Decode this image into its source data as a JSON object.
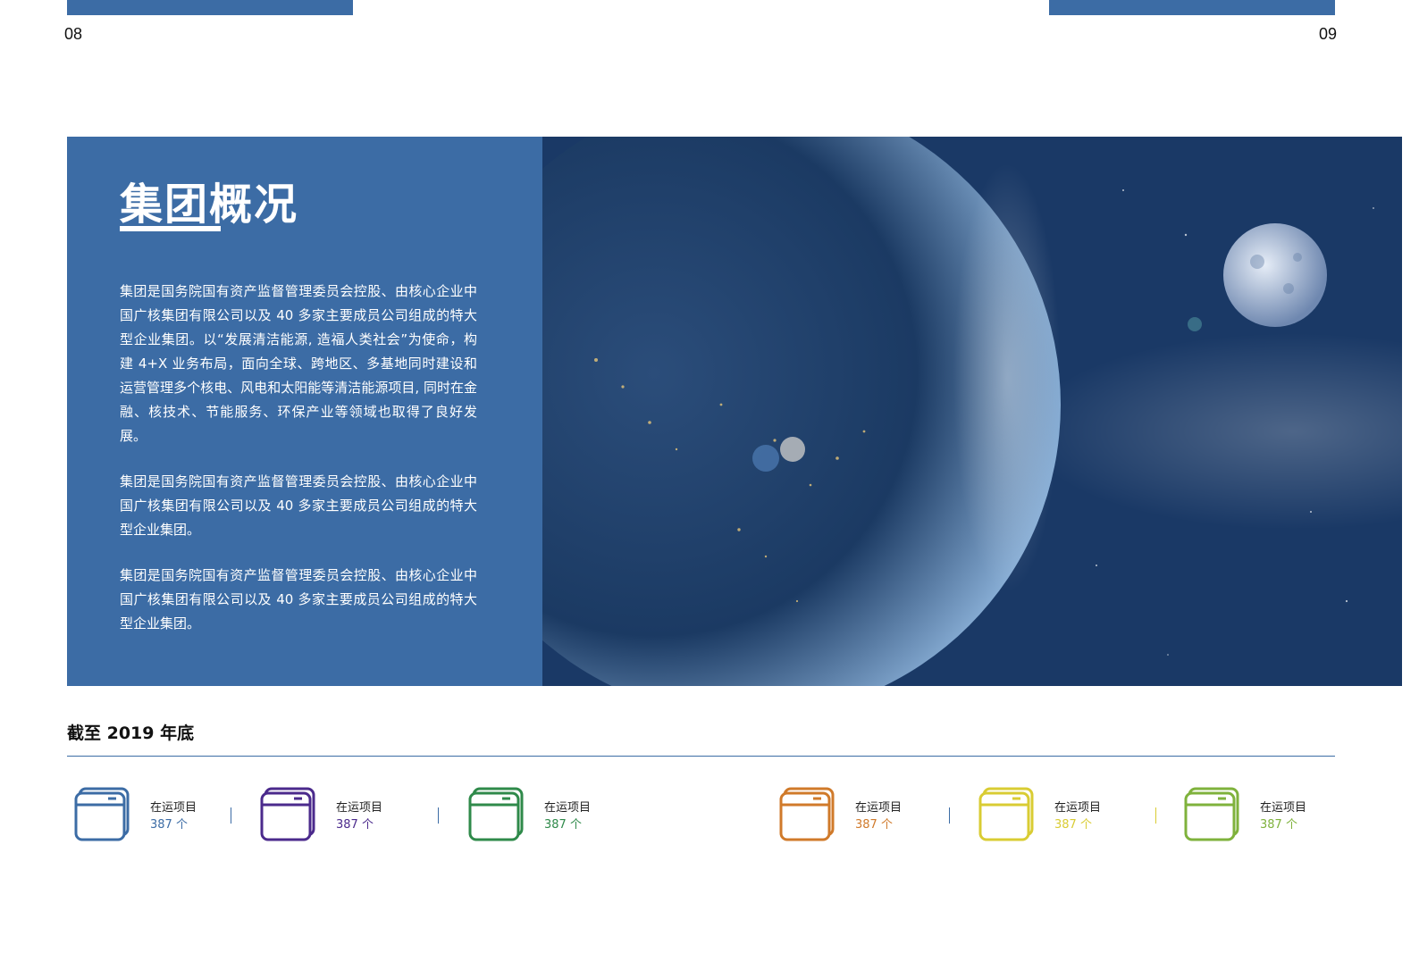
{
  "page_numbers": {
    "left": "08",
    "right": "09"
  },
  "colors": {
    "brand_blue": "#3c6ca5"
  },
  "hero": {
    "title": "集团概况",
    "paragraphs": [
      "集团是国务院国有资产监督管理委员会控股、由核心企业中国广核集团有限公司以及 40 多家主要成员公司组成的特大型企业集团。以“发展清洁能源, 造福人类社会”为使命，构建 4+X 业务布局，面向全球、跨地区、多基地同时建设和运营管理多个核电、风电和太阳能等清洁能源项目, 同时在金融、核技术、节能服务、环保产业等领域也取得了良好发展。",
      "集团是国务院国有资产监督管理委员会控股、由核心企业中国广核集团有限公司以及 40 多家主要成员公司组成的特大型企业集团。",
      "集团是国务院国有资产监督管理委员会控股、由核心企业中国广核集团有限公司以及 40 多家主要成员公司组成的特大型企业集团。"
    ]
  },
  "stats": {
    "heading": "截至 2019 年底",
    "items": [
      {
        "icon": "window-stack-icon",
        "label": "在运项目",
        "value": "387 个",
        "color": "#3c6ca5"
      },
      {
        "icon": "window-stack-icon",
        "label": "在运项目",
        "value": "387 个",
        "color": "#4b2a8c"
      },
      {
        "icon": "window-stack-icon",
        "label": "在运项目",
        "value": "387 个",
        "color": "#2f8a4a"
      },
      {
        "icon": "window-stack-icon",
        "label": "在运项目",
        "value": "387 个",
        "color": "#d07a2a"
      },
      {
        "icon": "window-stack-icon",
        "label": "在运项目",
        "value": "387 个",
        "color": "#d9cc33"
      },
      {
        "icon": "window-stack-icon",
        "label": "在运项目",
        "value": "387 个",
        "color": "#7fb23c"
      }
    ]
  }
}
